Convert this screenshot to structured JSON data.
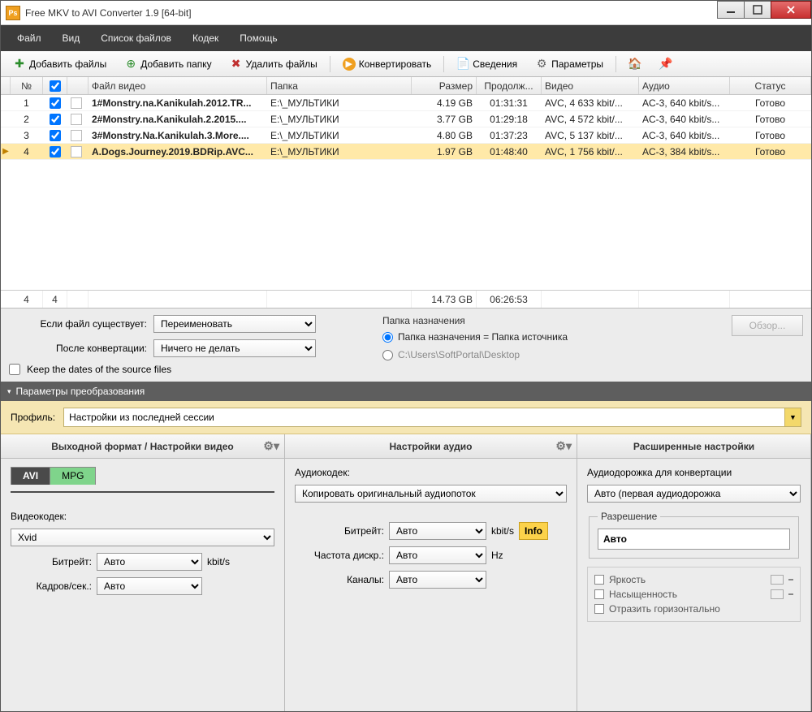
{
  "title": "Free MKV to AVI Converter 1.9  [64-bit]",
  "menu": [
    "Файл",
    "Вид",
    "Список файлов",
    "Кодек",
    "Помощь"
  ],
  "toolbar": {
    "add_files": "Добавить файлы",
    "add_folder": "Добавить папку",
    "delete_files": "Удалить файлы",
    "convert": "Конвертировать",
    "info": "Сведения",
    "params": "Параметры"
  },
  "columns": {
    "num": "№",
    "file": "Файл видео",
    "folder": "Папка",
    "size": "Размер",
    "dur": "Продолж...",
    "video": "Видео",
    "audio": "Аудио",
    "status": "Статус"
  },
  "rows": [
    {
      "n": "1",
      "file": "1#Monstry.na.Kanikulah.2012.TR...",
      "folder": "E:\\_МУЛЬТИКИ",
      "size": "4.19 GB",
      "dur": "01:31:31",
      "video": "AVC, 4 633 kbit/...",
      "audio": "AC-3, 640 kbit/s...",
      "status": "Готово",
      "sel": false
    },
    {
      "n": "2",
      "file": "2#Monstry.na.Kanikulah.2.2015....",
      "folder": "E:\\_МУЛЬТИКИ",
      "size": "3.77 GB",
      "dur": "01:29:18",
      "video": "AVC, 4 572 kbit/...",
      "audio": "AC-3, 640 kbit/s...",
      "status": "Готово",
      "sel": false
    },
    {
      "n": "3",
      "file": "3#Monstry.Na.Kanikulah.3.More....",
      "folder": "E:\\_МУЛЬТИКИ",
      "size": "4.80 GB",
      "dur": "01:37:23",
      "video": "AVC, 5 137 kbit/...",
      "audio": "AC-3, 640 kbit/s...",
      "status": "Готово",
      "sel": false
    },
    {
      "n": "4",
      "file": "A.Dogs.Journey.2019.BDRip.AVC...",
      "folder": "E:\\_МУЛЬТИКИ",
      "size": "1.97 GB",
      "dur": "01:48:40",
      "video": "AVC, 1 756 kbit/...",
      "audio": "AC-3, 384 kbit/s...",
      "status": "Готово",
      "sel": true
    }
  ],
  "totals": {
    "count": "4",
    "checked": "4",
    "size": "14.73 GB",
    "dur": "06:26:53"
  },
  "opts": {
    "if_exists_label": "Если файл существует:",
    "if_exists_value": "Переименовать",
    "after_conv_label": "После конвертации:",
    "after_conv_value": "Ничего не делать",
    "keep_dates": "Keep the dates of the source files",
    "dest_folder_title": "Папка назначения",
    "dest_same": "Папка назначения = Папка источника",
    "dest_custom": "C:\\Users\\SoftPortal\\Desktop",
    "browse": "Обзор..."
  },
  "panel": "Параметры преобразования",
  "profile_label": "Профиль:",
  "profile_value": "Настройки из последней сессии",
  "paneA": {
    "title": "Выходной формат / Настройки видео",
    "tab_avi": "AVI",
    "tab_mpg": "MPG",
    "vcodec_label": "Видеокодек:",
    "vcodec_value": "Xvid",
    "bitrate_label": "Битрейт:",
    "bitrate_value": "Авто",
    "bitrate_unit": "kbit/s",
    "fps_label": "Кадров/сек.:",
    "fps_value": "Авто"
  },
  "paneB": {
    "title": "Настройки аудио",
    "acodec_label": "Аудиокодек:",
    "acodec_value": "Копировать оригинальный аудиопоток",
    "bitrate_label": "Битрейт:",
    "bitrate_value": "Авто",
    "bitrate_unit": "kbit/s",
    "freq_label": "Частота дискр.:",
    "freq_value": "Авто",
    "freq_unit": "Hz",
    "channels_label": "Каналы:",
    "channels_value": "Авто",
    "info": "Info"
  },
  "paneC": {
    "title": "Расширенные настройки",
    "track_label": "Аудиодорожка для конвертации",
    "track_value": "Авто (первая аудиодорожка",
    "res_legend": "Разрешение",
    "res_value": "Авто",
    "brightness": "Яркость",
    "saturation": "Насыщенность",
    "flip": "Отразить горизонтально"
  }
}
